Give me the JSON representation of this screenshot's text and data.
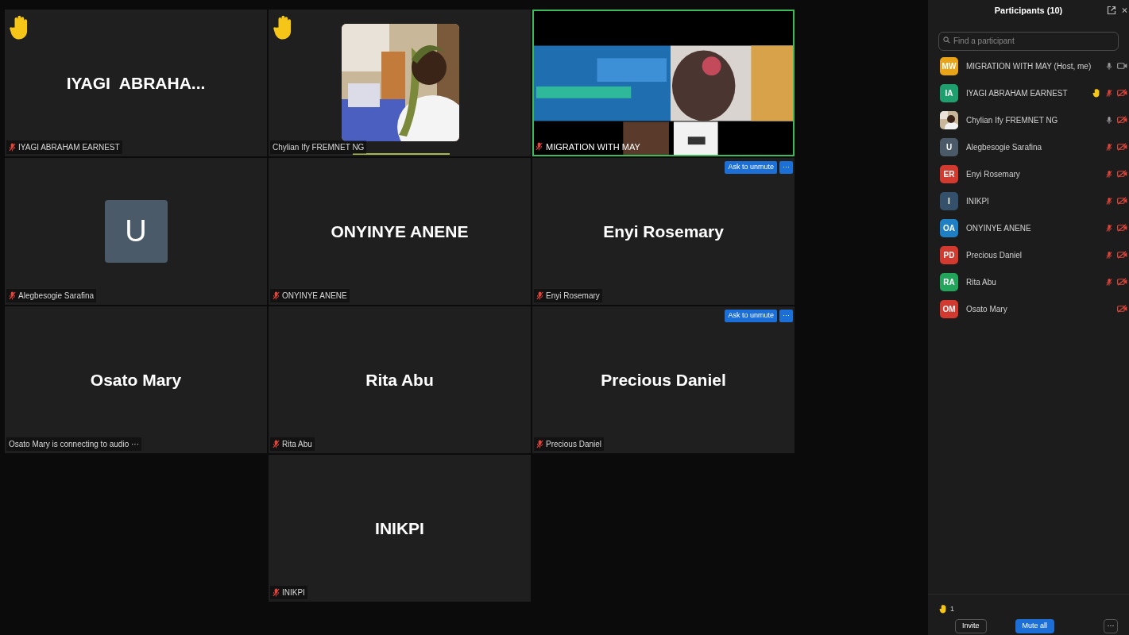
{
  "tiles": [
    {
      "kind": "name",
      "display_name": "IYAGI  ABRAHA...",
      "label": "IYAGI ABRAHAM EARNEST",
      "muted": true,
      "hand_raised": true,
      "active_speaker": false
    },
    {
      "kind": "video",
      "label": "Chylian Ify FREMNET NG",
      "muted": false,
      "hand_raised": true,
      "active_speaker": false
    },
    {
      "kind": "screen",
      "label": "MIGRATION WITH MAY",
      "muted": true,
      "hand_raised": false,
      "active_speaker": true
    },
    {
      "kind": "avatar",
      "initial": "U",
      "label": "Alegbesogie Sarafina",
      "muted": true,
      "hand_raised": false,
      "active_speaker": false
    },
    {
      "kind": "name",
      "display_name": "ONYINYE ANENE",
      "label": "ONYINYE ANENE",
      "muted": true,
      "hand_raised": false,
      "active_speaker": false
    },
    {
      "kind": "name",
      "display_name": "Enyi Rosemary",
      "label": "Enyi Rosemary",
      "muted": true,
      "hand_raised": false,
      "active_speaker": false,
      "unmute_button": "Ask to unmute",
      "more_button": "···"
    },
    {
      "kind": "name",
      "display_name": "Osato Mary",
      "label": "Osato Mary is connecting to audio ···",
      "muted": false,
      "hand_raised": false,
      "active_speaker": false
    },
    {
      "kind": "name",
      "display_name": "Rita Abu",
      "label": "Rita Abu",
      "muted": true,
      "hand_raised": false,
      "active_speaker": false
    },
    {
      "kind": "name",
      "display_name": "Precious Daniel",
      "label": "Precious Daniel",
      "muted": true,
      "hand_raised": false,
      "active_speaker": false,
      "unmute_button": "Ask to unmute",
      "more_button": "···"
    },
    {
      "kind": "name",
      "display_name": "INIKPI",
      "label": "INIKPI",
      "muted": true,
      "hand_raised": false,
      "active_speaker": false
    }
  ],
  "participants_panel": {
    "title": "Participants (10)",
    "search": {
      "placeholder": "Find a participant"
    },
    "participants": [
      {
        "kind": "initials",
        "initials": "MW",
        "color": "#e8a317",
        "name": "MIGRATION WITH MAY (Host, me)",
        "hand_raised": false,
        "audio_connected": true,
        "muted": false,
        "video_on": true
      },
      {
        "kind": "initials",
        "initials": "IA",
        "color": "#1f9e6e",
        "name": "IYAGI ABRAHAM EARNEST",
        "hand_raised": true,
        "audio_connected": true,
        "muted": true,
        "video_on": false
      },
      {
        "name": "Chylian Ify FREMNET NG",
        "hand_raised": false,
        "audio_connected": true,
        "muted": false,
        "video_on": false
      },
      {
        "kind": "initials",
        "initials": "U",
        "color": "#4a5a68",
        "name": "Alegbesogie Sarafina",
        "hand_raised": false,
        "audio_connected": true,
        "muted": true,
        "video_on": false
      },
      {
        "kind": "initials",
        "initials": "ER",
        "color": "#d23a2f",
        "name": "Enyi Rosemary",
        "hand_raised": false,
        "audio_connected": true,
        "muted": true,
        "video_on": false
      },
      {
        "kind": "initials",
        "initials": "I",
        "color": "#34506a",
        "name": "INIKPI",
        "hand_raised": false,
        "audio_connected": true,
        "muted": true,
        "video_on": false
      },
      {
        "kind": "initials",
        "initials": "OA",
        "color": "#1f7fc4",
        "name": "ONYINYE ANENE",
        "hand_raised": false,
        "audio_connected": true,
        "muted": true,
        "video_on": false
      },
      {
        "kind": "initials",
        "initials": "PD",
        "color": "#d23a2f",
        "name": "Precious Daniel",
        "hand_raised": false,
        "audio_connected": true,
        "muted": true,
        "video_on": false
      },
      {
        "kind": "initials",
        "initials": "RA",
        "color": "#22a55a",
        "name": "Rita Abu",
        "hand_raised": false,
        "audio_connected": true,
        "muted": true,
        "video_on": false
      },
      {
        "kind": "initials",
        "initials": "OM",
        "color": "#d23a2f",
        "name": "Osato Mary",
        "hand_raised": false,
        "audio_connected": false,
        "video_on": false
      }
    ],
    "raised_hands_count": "1",
    "buttons": [
      "Invite",
      "Mute all"
    ],
    "more_label": "···"
  }
}
